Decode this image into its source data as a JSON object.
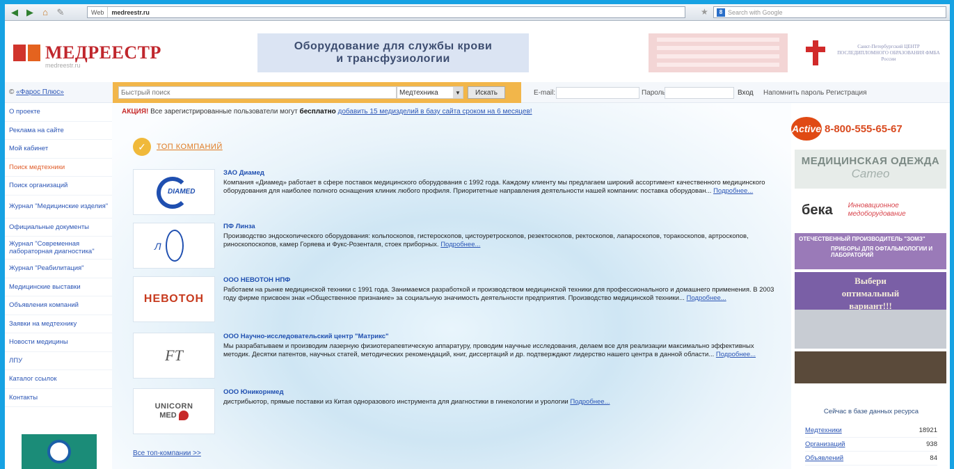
{
  "browser": {
    "site_id": "Web",
    "url": "medreestr.ru",
    "search_placeholder": "Search with Google"
  },
  "header": {
    "logo_name": "МЕДРЕЕСТР",
    "logo_sub": "medreestr.ru",
    "banner_line1": "Оборудование для службы крови",
    "banner_line2": "и трансфузиологии",
    "center_name": "Санкт-Петербургский ЦЕНТР ПОСЛЕДИПЛОМНОГО ОБРАЗОВАНИЯ ФМБА России"
  },
  "searchrow": {
    "pharos_prefix": "©",
    "pharos_link": "«Фарос Плюс»",
    "search_placeholder": "Быстрый поиск",
    "category": "Медтехника",
    "search_button": "Искать",
    "email_label": "E-mail:",
    "password_label": "Пароль:",
    "login_button": "Вход",
    "remind": "Напомнить пароль",
    "register": "Регистрация"
  },
  "nav": [
    "О проекте",
    "Реклама на сайте",
    "Мой кабинет",
    "Поиск медтехники",
    "Поиск организаций",
    "Журнал \"Медицинские изделия\"",
    "Официальные документы",
    "Журнал \"Современная лабораторная диагностика\"",
    "Журнал \"Реабилитация\"",
    "Медицинские выставки",
    "Объявления компаний",
    "Заявки на медтехнику",
    "Новости медицины",
    "ЛПУ",
    "Каталог ссылок",
    "Контакты"
  ],
  "promo": {
    "label": "АКЦИЯ!",
    "text": "Все зарегистрированные пользователи могут",
    "bold": "бесплатно",
    "link": "добавить 15 медизделий в базу сайта сроком на 6 месяцев!"
  },
  "top_companies_title": "ТОП КОМПАНИЙ",
  "companies": [
    {
      "name": "ЗАО Диамед",
      "logo_text": "DIAMED",
      "desc": "Компания «Диамед» работает в сфере поставок медицинского оборудования с 1992 года. Каждому клиенту мы предлагаем широкий ассортимент качественного медицинского оборудования для наиболее полного оснащения клиник любого профиля. Приоритетные направления деятельности нашей компании: поставка оборудован...",
      "more": "Подробнее..."
    },
    {
      "name": "ПФ Линза",
      "logo_text": "Л",
      "desc": "Производство эндоскопического оборудования: кольпоскопов, гистероскопов, цистоуретроскопов, резектоскопов, ректоскопов, лапароскопов, торакоскопов, артроскопов, риноскопоскопов, камер Горяева и Фукс-Розенталя, стоек приборных.",
      "more": "Подробнее..."
    },
    {
      "name": "ООО НЕВОТОН НПФ",
      "logo_text": "НЕВОТОН",
      "desc": "Работаем на рынке медицинской техники с 1991 года. Занимаемся разработкой и производством медицинской техники для профессионального и домашнего применения. В 2003 году фирме присвоен знак «Общественное признание» за социальную значимость деятельности предприятия. Производство медицинской техники...",
      "more": "Подробнее..."
    },
    {
      "name": "ООО Научно-исследовательский центр \"Матрикс\"",
      "logo_text": "FT",
      "desc": "Мы разрабатываем и производим лазерную физиотерапевтическую аппаратуру, проводим научные исследования, делаем все для реализации максимально эффективных методик. Десятки патентов, научных статей, методических рекомендаций, книг, диссертаций и др. подтверждают лидерство нашего центра в данной области...",
      "more": "Подробнее..."
    },
    {
      "name": "ООО Юникорнмед",
      "logo_text1": "UNICORN",
      "logo_text2": "MED",
      "desc": "дистрибьютор, прямые поставки из Китая одноразового инструмента для диагностики в гинекологии и урологии",
      "more": "Подробнее..."
    }
  ],
  "all_companies": "Все топ-компании >>",
  "right": {
    "active_badge": "Active",
    "phone": "8-800-555-65-67",
    "clothes_line1": "МЕДИЦИНСКАЯ ОДЕЖДА",
    "clothes_line2": "Cameo",
    "beka_name": "бека",
    "beka_slogan1": "Инновационное",
    "beka_slogan2": "медоборудование",
    "zomz_line1": "ОТЕЧЕСТВЕННЫЙ ПРОИЗВОДИТЕЛЬ \"ЗОМЗ\"",
    "zomz_line2": "ПРИБОРЫ ДЛЯ ОФТАЛЬМОЛОГИИ И ЛАБОРАТОРИЙ",
    "choose_line1": "Выбери",
    "choose_line2": "оптимальный",
    "choose_line3": "вариант!!!",
    "stats_title": "Сейчас в базе данных ресурса",
    "stats": [
      {
        "label": "Медтехники",
        "value": "18921"
      },
      {
        "label": "Организаций",
        "value": "938"
      },
      {
        "label": "Объявлений",
        "value": "84"
      }
    ]
  }
}
